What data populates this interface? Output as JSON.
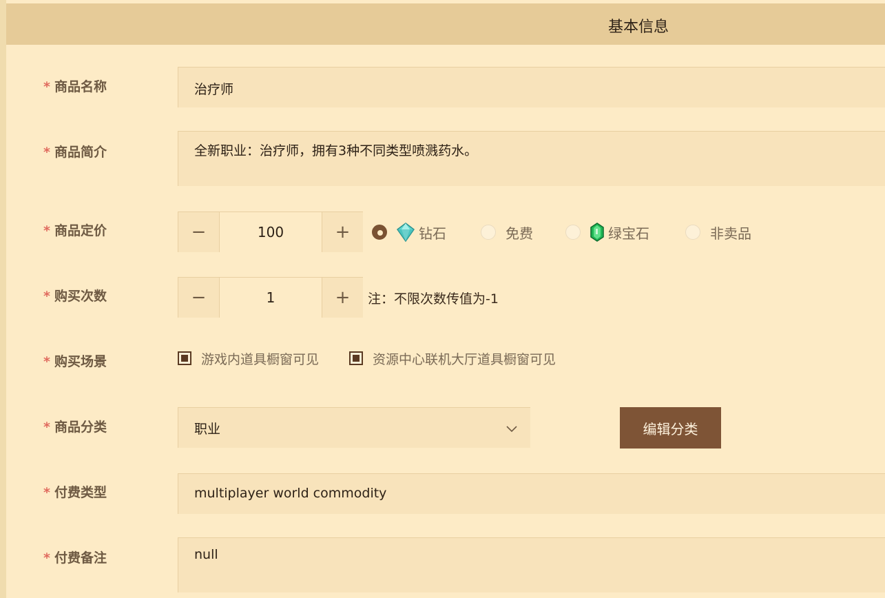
{
  "header": {
    "title": "基本信息"
  },
  "required_mark": "*",
  "form": {
    "name": {
      "label": "商品名称",
      "value": "治疗师"
    },
    "intro": {
      "label": "商品简介",
      "value": "全新职业：治疗师，拥有3种不同类型喷溅药水。"
    },
    "price": {
      "label": "商品定价",
      "value": "100",
      "decrement": "−",
      "increment": "+",
      "currency_options": [
        {
          "label": "钻石",
          "icon": "diamond-icon",
          "selected": true
        },
        {
          "label": "免费",
          "icon": null,
          "selected": false
        },
        {
          "label": "绿宝石",
          "icon": "emerald-icon",
          "selected": false
        },
        {
          "label": "非卖品",
          "icon": null,
          "selected": false
        }
      ]
    },
    "purchase_count": {
      "label": "购买次数",
      "value": "1",
      "decrement": "−",
      "increment": "+",
      "note": "注：不限次数传值为-1"
    },
    "purchase_scene": {
      "label": "购买场景",
      "options": [
        {
          "label": "游戏内道具橱窗可见",
          "checked": true
        },
        {
          "label": "资源中心联机大厅道具橱窗可见",
          "checked": true
        }
      ]
    },
    "category": {
      "label": "商品分类",
      "value": "职业",
      "edit_button": "编辑分类"
    },
    "pay_type": {
      "label": "付费类型",
      "value": "multiplayer world commodity"
    },
    "pay_note": {
      "label": "付费备注",
      "value": "null"
    }
  },
  "colors": {
    "accent": "#7e5436",
    "required": "#e06a5e",
    "header_bg": "#e6cb98",
    "panel_bg": "#fdebc6",
    "field_bg": "#f8e3bb"
  }
}
